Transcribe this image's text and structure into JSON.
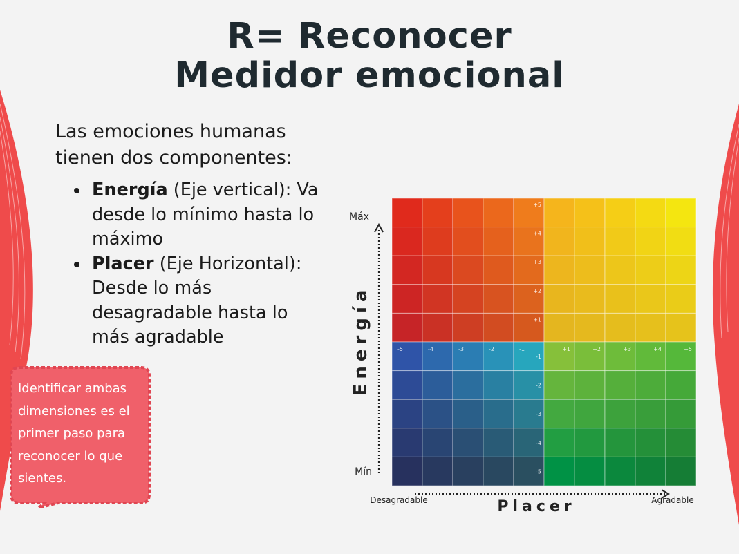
{
  "slide": {
    "title_line1": "R= Reconocer",
    "title_line2": "Medidor emocional",
    "intro": "Las emociones humanas tienen dos componentes:",
    "bullets": [
      {
        "term": "Energía",
        "rest": " (Eje vertical): Va desde lo mínimo hasta lo máximo"
      },
      {
        "term": "Placer",
        "rest": " (Eje Horizontal): Desde lo más desagradable hasta lo más agradable"
      }
    ],
    "callout": "Identificar ambas dimensiones es el primer paso para reconocer lo que sientes."
  },
  "chart_data": {
    "type": "heatmap",
    "title": "",
    "xlabel": "Placer",
    "ylabel": "Energía",
    "x_min_label": "Desagradable",
    "x_max_label": "Agradable",
    "y_min_label": "Mín",
    "y_max_label": "Máx",
    "x_values": [
      -5,
      -4,
      -3,
      -2,
      -1,
      1,
      2,
      3,
      4,
      5
    ],
    "y_values": [
      5,
      4,
      3,
      2,
      1,
      -1,
      -2,
      -3,
      -4,
      -5
    ],
    "x_tick_labels": [
      "-5",
      "-4",
      "-3",
      "-2",
      "-1",
      "+1",
      "+2",
      "+3",
      "+4",
      "+5"
    ],
    "y_tick_labels": [
      "+5",
      "+4",
      "+3",
      "+2",
      "+1",
      "-1",
      "-2",
      "-3",
      "-4",
      "-5"
    ],
    "quadrant_colors": {
      "high_energy_unpleasant": "#e02a1c",
      "high_energy_pleasant": "#f2c40f",
      "low_energy_unpleasant": "#22407e",
      "low_energy_pleasant": "#2fa64a"
    }
  }
}
